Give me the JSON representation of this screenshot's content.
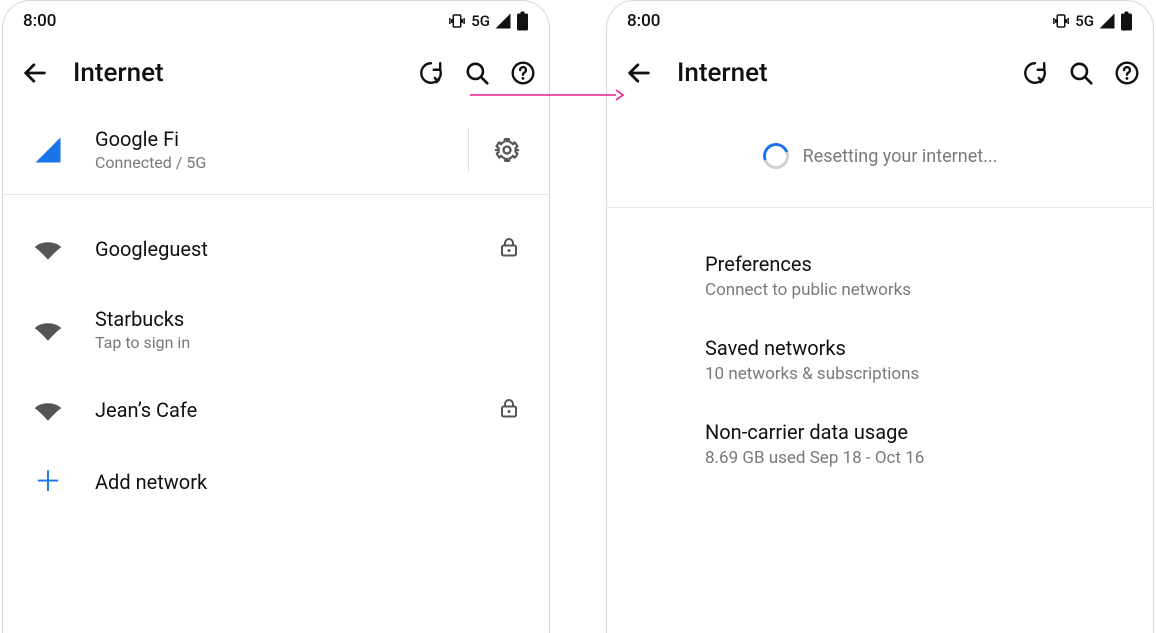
{
  "status": {
    "time": "8:00",
    "network_label": "5G"
  },
  "toolbar": {
    "title": "Internet"
  },
  "left": {
    "carrier": {
      "name": "Google Fi",
      "status": "Connected / 5G"
    },
    "wifi": [
      {
        "name": "Googleguest",
        "locked": true,
        "sub": ""
      },
      {
        "name": "Starbucks",
        "locked": false,
        "sub": "Tap to sign in"
      },
      {
        "name": "Jean’s Cafe",
        "locked": true,
        "sub": ""
      }
    ],
    "add_label": "Add network"
  },
  "right": {
    "loading_label": "Resetting your internet...",
    "settings": [
      {
        "title": "Preferences",
        "sub": "Connect to public networks"
      },
      {
        "title": "Saved networks",
        "sub": "10 networks & subscriptions"
      },
      {
        "title": "Non-carrier data usage",
        "sub": "8.69 GB used Sep 18 - Oct 16"
      }
    ]
  }
}
